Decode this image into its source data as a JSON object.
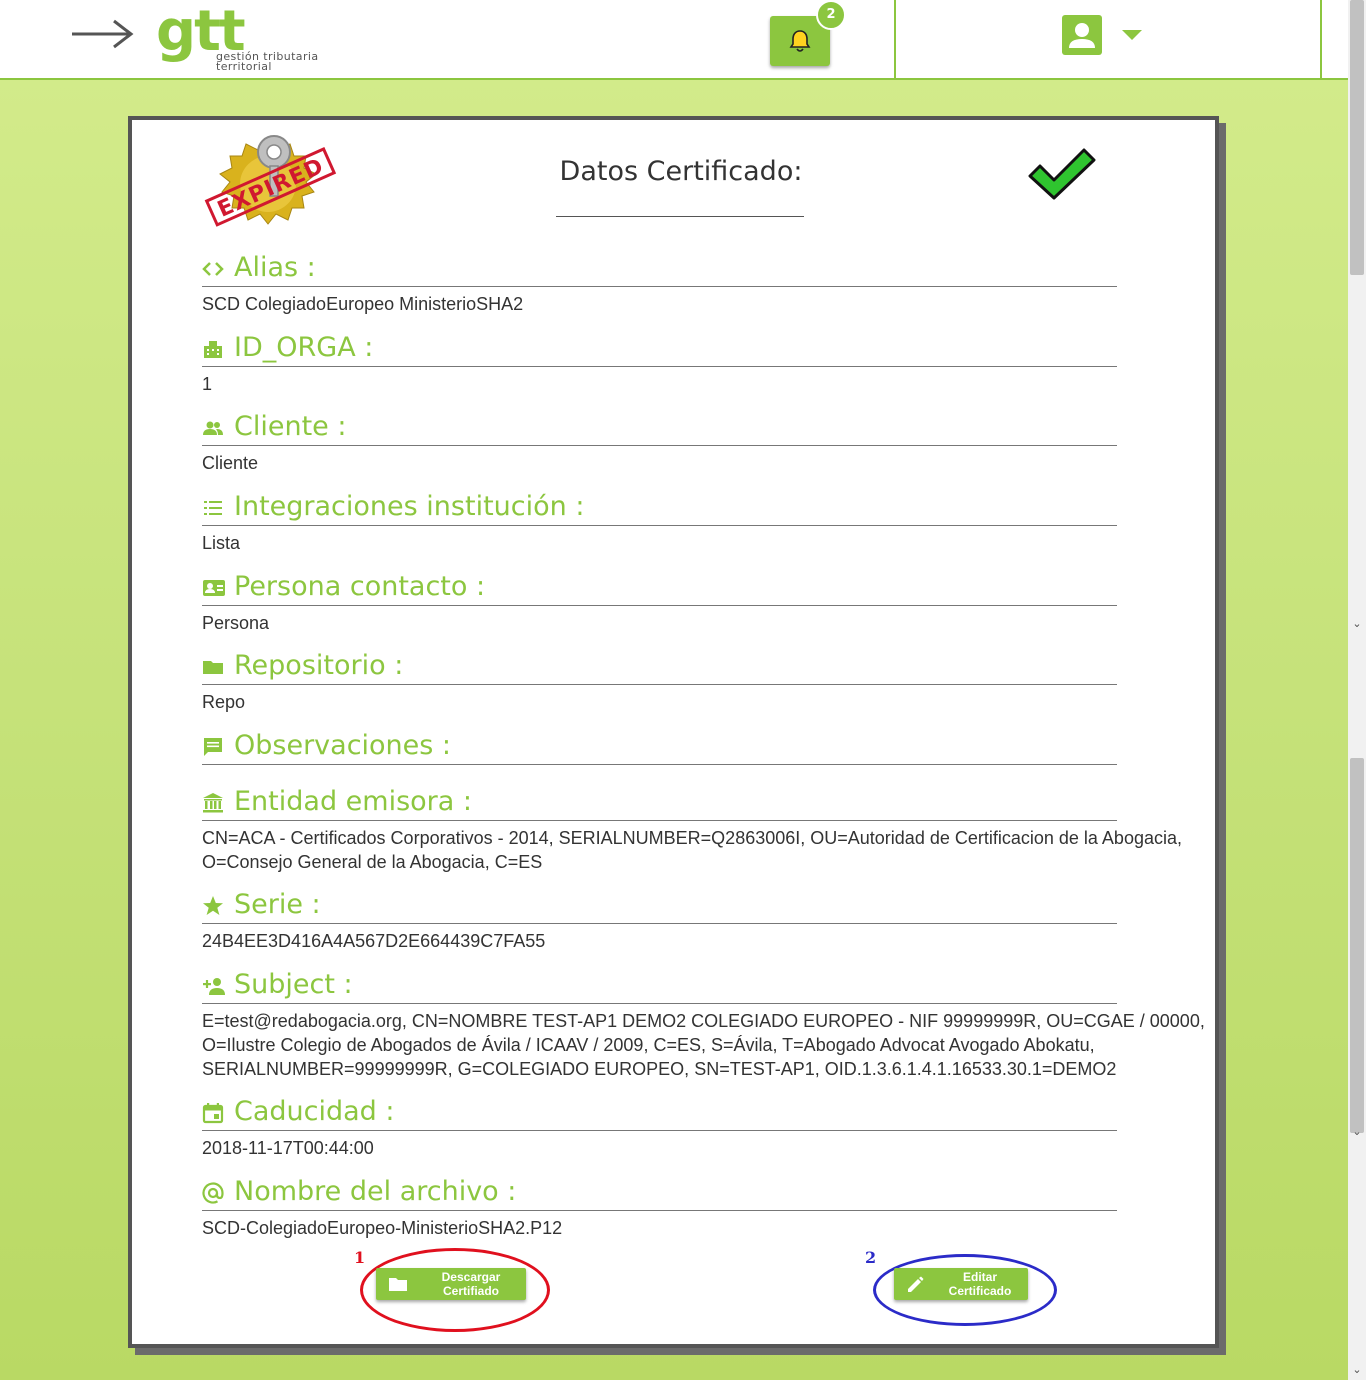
{
  "header": {
    "logo_text": "gtt",
    "logo_subtitle_line1": "gestión tributaria",
    "logo_subtitle_line2": "territorial",
    "notifications_count": "2"
  },
  "card": {
    "badge_text": "EXPIRED",
    "title": "Datos Certificado:",
    "fields": [
      {
        "icon": "code-icon",
        "label": "Alias :",
        "value": "SCD ColegiadoEuropeo MinisterioSHA2"
      },
      {
        "icon": "building-icon",
        "label": "ID_ORGA :",
        "value": "1"
      },
      {
        "icon": "people-icon",
        "label": "Cliente :",
        "value": "Cliente"
      },
      {
        "icon": "list-icon",
        "label": "Integraciones institución :",
        "value": "Lista"
      },
      {
        "icon": "contact-card-icon",
        "label": "Persona contacto :",
        "value": "Persona"
      },
      {
        "icon": "folder-icon",
        "label": "Repositorio :",
        "value": "Repo"
      },
      {
        "icon": "comment-icon",
        "label": "Observaciones :",
        "value": ""
      },
      {
        "icon": "bank-icon",
        "label": "Entidad emisora :",
        "value": "CN=ACA - Certificados Corporativos - 2014, SERIALNUMBER=Q2863006I, OU=Autoridad de Certificacion de la Abogacia, O=Consejo General de la Abogacia, C=ES"
      },
      {
        "icon": "star-icon",
        "label": "Serie :",
        "value": "24B4EE3D416A4A567D2E664439C7FA55"
      },
      {
        "icon": "person-add-icon",
        "label": "Subject :",
        "value": "E=test@redabogacia.org, CN=NOMBRE TEST-AP1 DEMO2 COLEGIADO EUROPEO - NIF 99999999R, OU=CGAE / 00000, O=Ilustre Colegio de Abogados de Ávila / ICAAV / 2009, C=ES, S=Ávila, T=Abogado Advocat Avogado Abokatu, SERIALNUMBER=99999999R, G=COLEGIADO EUROPEO, SN=TEST-AP1, OID.1.3.6.1.4.1.16533.30.1=DEMO2"
      },
      {
        "icon": "calendar-icon",
        "label": "Caducidad :",
        "value": "2018-11-17T00:44:00"
      },
      {
        "icon": "at-icon",
        "label": "Nombre del archivo :",
        "value": "SCD-ColegiadoEuropeo-MinisterioSHA2.P12"
      }
    ],
    "download_button": {
      "line1": "Descargar",
      "line2": "Certifiado"
    },
    "edit_button": {
      "line1": "Editar",
      "line2": "Certificado"
    },
    "annotation_1": "1",
    "annotation_2": "2",
    "colors": {
      "accent": "#8cc63f",
      "annotation_red": "#e0101e",
      "annotation_blue": "#2b2bc8"
    }
  }
}
